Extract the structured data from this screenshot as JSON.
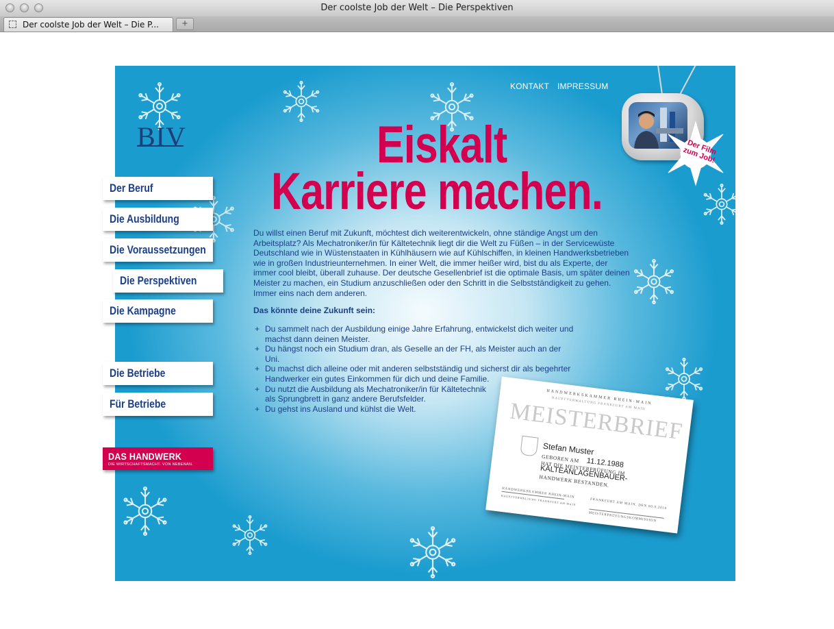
{
  "window": {
    "title": "Der coolste Job der Welt – Die Perspektiven",
    "tab_label": "Der coolste Job der Welt – Die P...",
    "newtab_label": "+"
  },
  "logo": {
    "text": "BIV"
  },
  "topnav": {
    "contact": "KONTAKT",
    "imprint": "IMPRESSUM"
  },
  "headline": {
    "line1": "Eiskalt",
    "line2": "Karriere machen."
  },
  "intro": "Du willst einen Beruf mit Zukunft, möchtest dich weiterentwickeln, ohne ständige Angst um den Arbeitsplatz? Als Mechatroniker/in für Kältetechnik liegt dir die Welt zu Füßen – in der Servicewüste Deutschland wie in Wüstenstaaten in Kühlhäusern wie auf Kühlschiffen, in kleinen Handwerksbetrieben wie in großen Industrieunternehmen. In einer Welt, die immer heißer wird, bist du als Experte, der immer cool bleibt, überall zuhause. Der deutsche Gesellenbrief ist die optimale Basis, um später deinen Meister zu machen, ein Studium anzuschließen oder den Schritt in die Selbstständigkeit zu gehen. Immer eins nach dem anderen.",
  "subhead": "Das könnte deine Zukunft sein:",
  "bullets": [
    "Du sammelt nach der Ausbildung einige Jahre Erfahrung, entwickelst dich weiter und machst dann deinen Meister.",
    "Du hängst noch ein Studium dran, als Geselle an der FH, als Meister auch an der Uni.",
    "Du machst dich alleine oder mit anderen selbstständig und sicherst dir als begehrter Handwerker ein gutes Einkommen für dich und deine Familie.",
    "Du nutzt die Ausbildung als Mechatroniker/in für Kältetechnik als Sprungbrett in ganz andere Berufsfelder.",
    "Du gehst ins Ausland und kühlst die Welt."
  ],
  "nav": {
    "beruf": "Der Beruf",
    "ausbildung": "Die Ausbildung",
    "voraussetzungen": "Die Voraussetzungen",
    "perspektiven": "Die Perspektiven",
    "kampagne": "Die Kampagne",
    "betriebe": "Die Betriebe",
    "fuer_betriebe": "Für Betriebe"
  },
  "handwerk": {
    "main": "DAS HANDWERK",
    "sub": "DIE WIRTSCHAFTSMACHT. VON NEBENAN."
  },
  "film_badge": {
    "line1": "Der Film",
    "line2": "zum Job!"
  },
  "certificate": {
    "chamber": "HANDWERKSKAMMER RHEIN-MAIN",
    "chamber_sub": "HAUPTVERWALTUNG FRANKFURT AM MAIN",
    "title": "MEISTERBRIEF",
    "name": "Stefan Muster",
    "born_label": "GEBOREN AM",
    "born_date": "11.12.1988",
    "exam_text": "HAT DIE MEISTERPRÜFUNG IM",
    "trade": "KÄLTEANLAGENBAUER-",
    "passed": "HANDWERK BESTANDEN.",
    "sig_left": "HANDWERKSKAMMER RHEIN-MAIN",
    "sig_left_sub": "HAUPTVERWALTUNG FRANKFURT AM MAIN",
    "place_date": "FRANKFURT AM MAIN, DEN 00.0.2010",
    "sig_right": "MEISTERPRÜFUNGSKOMMISSION"
  },
  "colors": {
    "accent": "#d2004e",
    "navy": "#1b3f8a",
    "sky": "#1b9ccf"
  }
}
